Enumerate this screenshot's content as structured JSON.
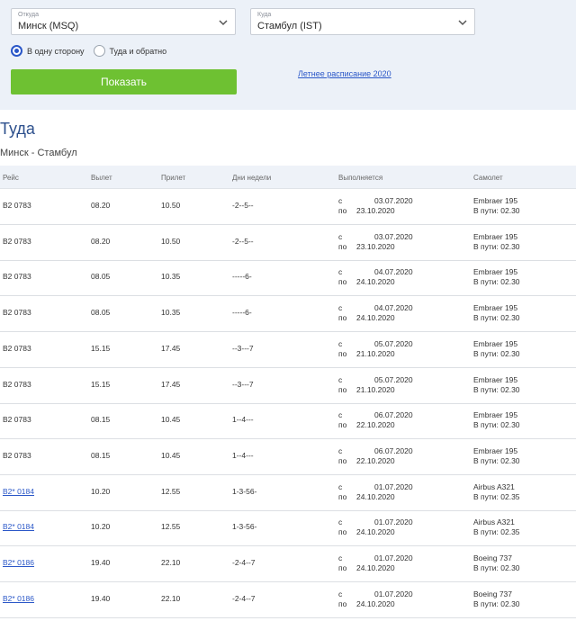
{
  "search": {
    "from_label": "Откуда",
    "from_value": "Минск (MSQ)",
    "to_label": "Куда",
    "to_value": "Стамбул (IST)",
    "one_way_label": "В одну сторону",
    "round_trip_label": "Туда и обратно",
    "show_button": "Показать",
    "summer_link": "Летнее расписание 2020"
  },
  "section_title": "Туда",
  "route_subtitle": "Минск - Стамбул",
  "columns": [
    "Рейс",
    "Вылет",
    "Прилет",
    "Дни недели",
    "Выполняется",
    "Самолет"
  ],
  "from_prefix": "с",
  "to_prefix": "по",
  "rows": [
    {
      "flight": "B2 0783",
      "dep": "08.20",
      "arr": "10.50",
      "days": "-2--5--",
      "from": "03.07.2020",
      "to": "23.10.2020",
      "plane": "Embraer 195",
      "travel": "В пути: 02.30"
    },
    {
      "flight": "B2 0783",
      "dep": "08.20",
      "arr": "10.50",
      "days": "-2--5--",
      "from": "03.07.2020",
      "to": "23.10.2020",
      "plane": "Embraer 195",
      "travel": "В пути: 02.30"
    },
    {
      "flight": "B2 0783",
      "dep": "08.05",
      "arr": "10.35",
      "days": "-----6-",
      "from": "04.07.2020",
      "to": "24.10.2020",
      "plane": "Embraer 195",
      "travel": "В пути: 02.30"
    },
    {
      "flight": "B2 0783",
      "dep": "08.05",
      "arr": "10.35",
      "days": "-----6-",
      "from": "04.07.2020",
      "to": "24.10.2020",
      "plane": "Embraer 195",
      "travel": "В пути: 02.30"
    },
    {
      "flight": "B2 0783",
      "dep": "15.15",
      "arr": "17.45",
      "days": "--3---7",
      "from": "05.07.2020",
      "to": "21.10.2020",
      "plane": "Embraer 195",
      "travel": "В пути: 02.30"
    },
    {
      "flight": "B2 0783",
      "dep": "15.15",
      "arr": "17.45",
      "days": "--3---7",
      "from": "05.07.2020",
      "to": "21.10.2020",
      "plane": "Embraer 195",
      "travel": "В пути: 02.30"
    },
    {
      "flight": "B2 0783",
      "dep": "08.15",
      "arr": "10.45",
      "days": "1--4---",
      "from": "06.07.2020",
      "to": "22.10.2020",
      "plane": "Embraer 195",
      "travel": "В пути: 02.30"
    },
    {
      "flight": "B2 0783",
      "dep": "08.15",
      "arr": "10.45",
      "days": "1--4---",
      "from": "06.07.2020",
      "to": "22.10.2020",
      "plane": "Embraer 195",
      "travel": "В пути: 02.30"
    },
    {
      "flight": "B2* 0184",
      "link": true,
      "dep": "10.20",
      "arr": "12.55",
      "days": "1-3-56-",
      "from": "01.07.2020",
      "to": "24.10.2020",
      "plane": "Airbus A321",
      "travel": "В пути: 02.35"
    },
    {
      "flight": "B2* 0184",
      "link": true,
      "dep": "10.20",
      "arr": "12.55",
      "days": "1-3-56-",
      "from": "01.07.2020",
      "to": "24.10.2020",
      "plane": "Airbus A321",
      "travel": "В пути: 02.35"
    },
    {
      "flight": "B2* 0186",
      "link": true,
      "dep": "19.40",
      "arr": "22.10",
      "days": "-2-4--7",
      "from": "01.07.2020",
      "to": "24.10.2020",
      "plane": "Boeing 737",
      "travel": "В пути: 02.30"
    },
    {
      "flight": "B2* 0186",
      "link": true,
      "dep": "19.40",
      "arr": "22.10",
      "days": "-2-4--7",
      "from": "01.07.2020",
      "to": "24.10.2020",
      "plane": "Boeing 737",
      "travel": "В пути: 02.30"
    }
  ],
  "colors": {
    "accent": "#2a57c8",
    "button": "#6ec132",
    "panel": "#ecf1f8",
    "title": "#2c4f8c"
  }
}
